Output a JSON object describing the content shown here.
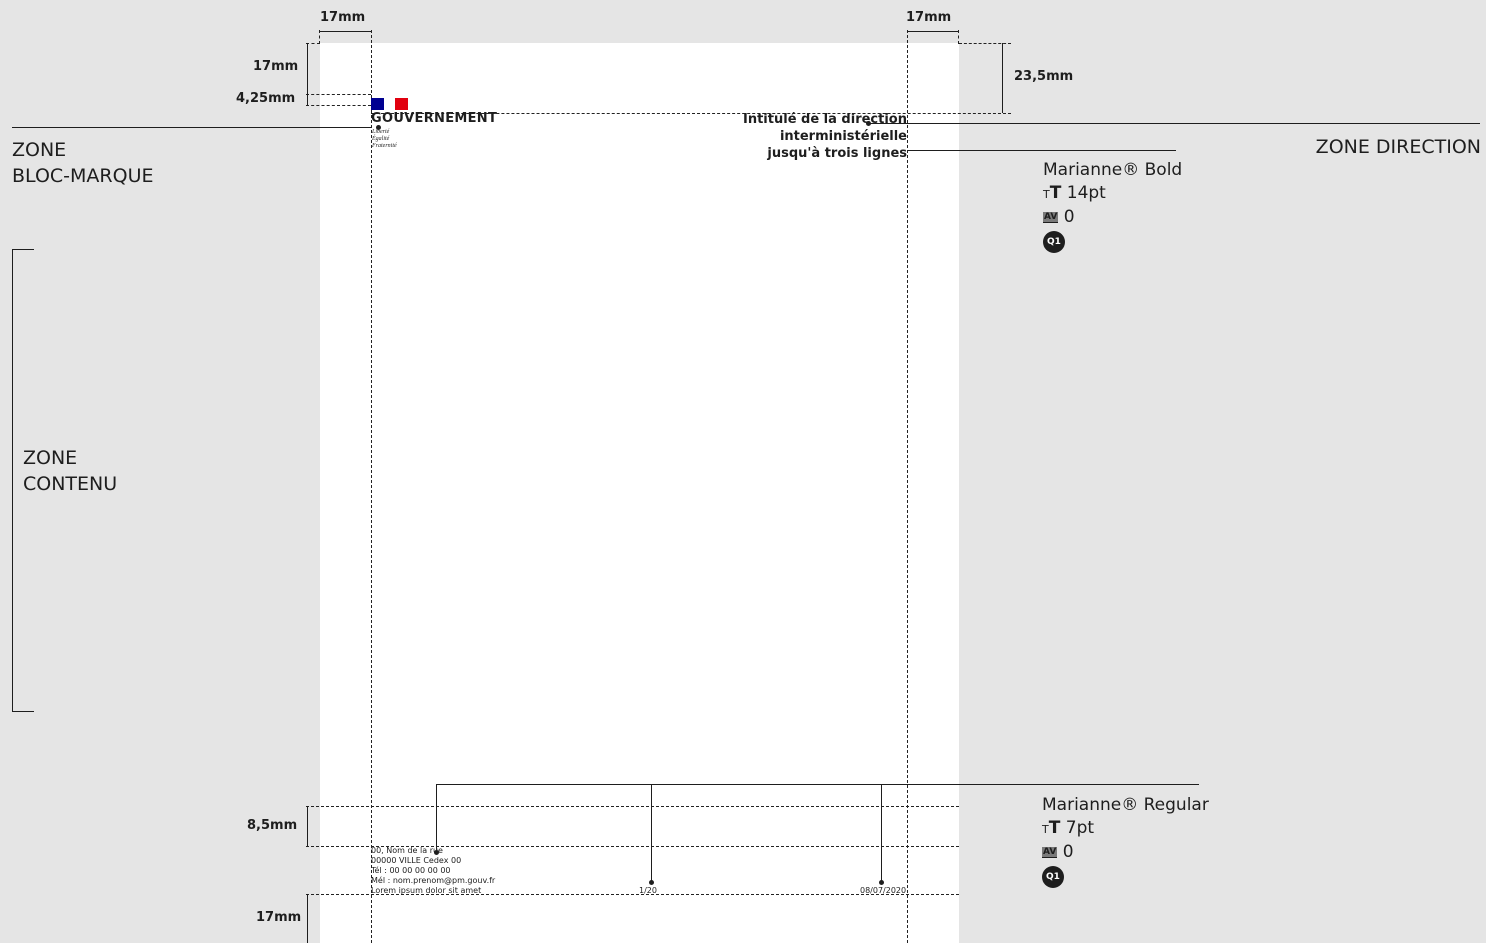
{
  "dimensions": {
    "margin_left": "17mm",
    "margin_right": "17mm",
    "top_margin": "17mm",
    "logo_height": "4,25mm",
    "direction_offset": "23,5mm",
    "footer_height": "8,5mm",
    "bottom_margin": "17mm"
  },
  "zones": {
    "bloc_marque": [
      "ZONE",
      "BLOC-MARQUE"
    ],
    "contenu": [
      "ZONE",
      "CONTENU"
    ],
    "direction": "ZONE DIRECTION"
  },
  "bloc_marque": {
    "wordmark": "GOUVERNEMENT",
    "motto": [
      "Liberté",
      "Égalité",
      "Fraternité"
    ],
    "flag_colors": [
      "#000091",
      "#ffffff",
      "#e1000f"
    ]
  },
  "direction": {
    "lines": [
      "Intitulé de la direction",
      "interministérielle",
      "jusqu'à trois lignes"
    ]
  },
  "direction_spec": {
    "font": "Marianne® Bold",
    "size": "14pt",
    "tracking": "0",
    "q1": "Q1"
  },
  "footer": {
    "address": [
      "00, Nom de la rue",
      "00000 VILLE Cedex 00",
      "Tél : 00 00 00 00 00",
      "Mél : nom.prenom@pm.gouv.fr",
      "Lorem ipsum dolor sit amet"
    ],
    "page": "1/20",
    "date": "08/07/2020"
  },
  "footer_spec": {
    "font": "Marianne® Regular",
    "size": "7pt",
    "tracking": "0",
    "q1": "Q1"
  }
}
